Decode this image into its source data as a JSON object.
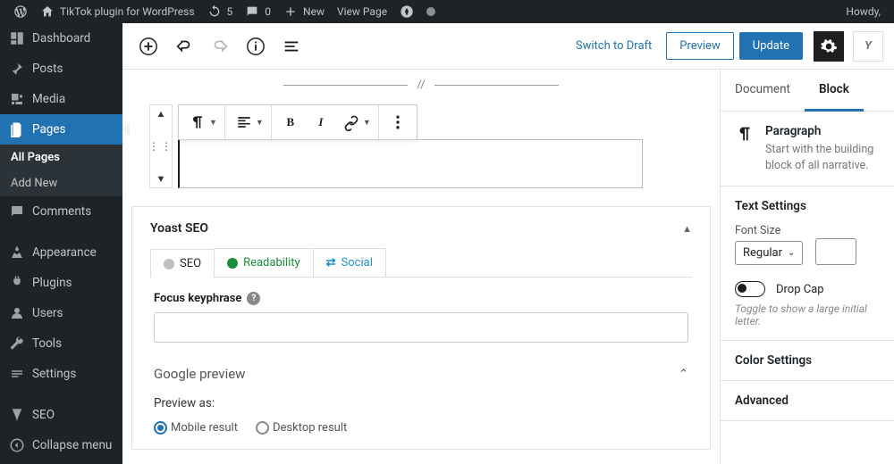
{
  "adminbar": {
    "site_title": "TikTok plugin for WordPress",
    "updates": "5",
    "comments": "0",
    "new": "New",
    "view_page": "View Page",
    "howdy": "Howdy,"
  },
  "sidebar": {
    "items": [
      {
        "label": "Dashboard",
        "icon": "dashboard-icon"
      },
      {
        "label": "Posts",
        "icon": "posts-icon"
      },
      {
        "label": "Media",
        "icon": "media-icon"
      },
      {
        "label": "Pages",
        "icon": "pages-icon",
        "active": true,
        "sub": [
          {
            "label": "All Pages",
            "current": true
          },
          {
            "label": "Add New"
          }
        ]
      },
      {
        "label": "Comments",
        "icon": "comments-icon"
      },
      {
        "label": "Appearance",
        "icon": "appearance-icon"
      },
      {
        "label": "Plugins",
        "icon": "plugins-icon"
      },
      {
        "label": "Users",
        "icon": "users-icon"
      },
      {
        "label": "Tools",
        "icon": "tools-icon"
      },
      {
        "label": "Settings",
        "icon": "settings-icon"
      },
      {
        "label": "SEO",
        "icon": "seo-icon"
      }
    ],
    "collapse": "Collapse menu"
  },
  "editor": {
    "switch_draft": "Switch to Draft",
    "preview": "Preview",
    "update": "Update",
    "divider_glyph": "//"
  },
  "yoast": {
    "title": "Yoast SEO",
    "tabs": {
      "seo": "SEO",
      "readability": "Readability",
      "social": "Social"
    },
    "focus_label": "Focus keyphrase",
    "google_preview": "Google preview",
    "preview_as": "Preview as:",
    "mobile": "Mobile result",
    "desktop": "Desktop result"
  },
  "inspector": {
    "tabs": {
      "document": "Document",
      "block": "Block"
    },
    "block_name": "Paragraph",
    "block_desc": "Start with the building block of all narrative.",
    "text_settings": "Text Settings",
    "font_size_label": "Font Size",
    "font_size_value": "Regular",
    "drop_cap": "Drop Cap",
    "drop_cap_hint": "Toggle to show a large initial letter.",
    "color_settings": "Color Settings",
    "advanced": "Advanced"
  }
}
